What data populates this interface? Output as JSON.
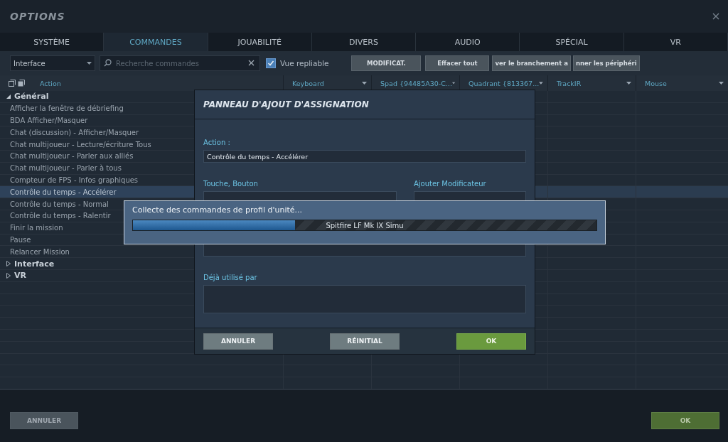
{
  "window": {
    "title": "OPTIONS"
  },
  "tabs": [
    {
      "label": "SYSTÈME",
      "selected": false
    },
    {
      "label": "COMMANDES",
      "selected": true
    },
    {
      "label": "JOUABILITÉ",
      "selected": false
    },
    {
      "label": "DIVERS",
      "selected": false
    },
    {
      "label": "AUDIO",
      "selected": false
    },
    {
      "label": "SPÉCIAL",
      "selected": false
    },
    {
      "label": "VR",
      "selected": false
    }
  ],
  "toolbar": {
    "category": "Interface",
    "search": {
      "placeholder": "Recherche commandes"
    },
    "collapsible_view": {
      "label": "Vue repliable",
      "checked": true
    },
    "buttons": [
      "MODIFICAT.",
      "Effacer tout",
      "ver le branchement a",
      "nner les périphéri"
    ]
  },
  "table": {
    "columns": [
      "Action",
      "Keyboard",
      "Spad {94485A30-C...",
      "Quadrant {813367...",
      "TrackIR",
      "Mouse"
    ],
    "tree": [
      {
        "label": "Général",
        "expanded": true,
        "selected": false,
        "children": [
          {
            "label": "Afficher la fenêtre de débriefing",
            "selected": false
          },
          {
            "label": "BDA Afficher/Masquer",
            "selected": false
          },
          {
            "label": "Chat (discussion) - Afficher/Masquer",
            "selected": false
          },
          {
            "label": "Chat multijoueur - Lecture/écriture Tous",
            "selected": false
          },
          {
            "label": "Chat multijoueur - Parler aux alliés",
            "selected": false
          },
          {
            "label": "Chat multijoueur - Parler à tous",
            "selected": false
          },
          {
            "label": "Compteur de FPS - Infos graphiques",
            "selected": false
          },
          {
            "label": "Contrôle du temps - Accélérer",
            "selected": true
          },
          {
            "label": "Contrôle du temps - Normal",
            "selected": false
          },
          {
            "label": "Contrôle du temps - Ralentir",
            "selected": false
          },
          {
            "label": "Finir la mission",
            "selected": false
          },
          {
            "label": "Pause",
            "selected": false
          },
          {
            "label": "Relancer Mission",
            "selected": false
          }
        ]
      },
      {
        "label": "Interface",
        "expanded": false,
        "selected": false
      },
      {
        "label": "VR",
        "expanded": false,
        "selected": false
      }
    ]
  },
  "footer": {
    "buttons": [
      "ANNULER",
      "OK"
    ]
  },
  "dialog": {
    "title": "PANNEAU D'AJOUT D'ASSIGNATION",
    "action_label": "Action :",
    "action_value": "Contrôle du temps - Accélérer",
    "key_label": "Touche, Bouton",
    "modifier_label": "Ajouter Modificateur",
    "used_by_label": "Déjà utilisé par",
    "buttons": [
      "ANNULER",
      "RÉINITIAL",
      "OK"
    ]
  },
  "progress": {
    "message": "Collecte des commandes de profil d'unité...",
    "item": "Spitfire LF Mk IX Simu",
    "level": 0.35
  }
}
